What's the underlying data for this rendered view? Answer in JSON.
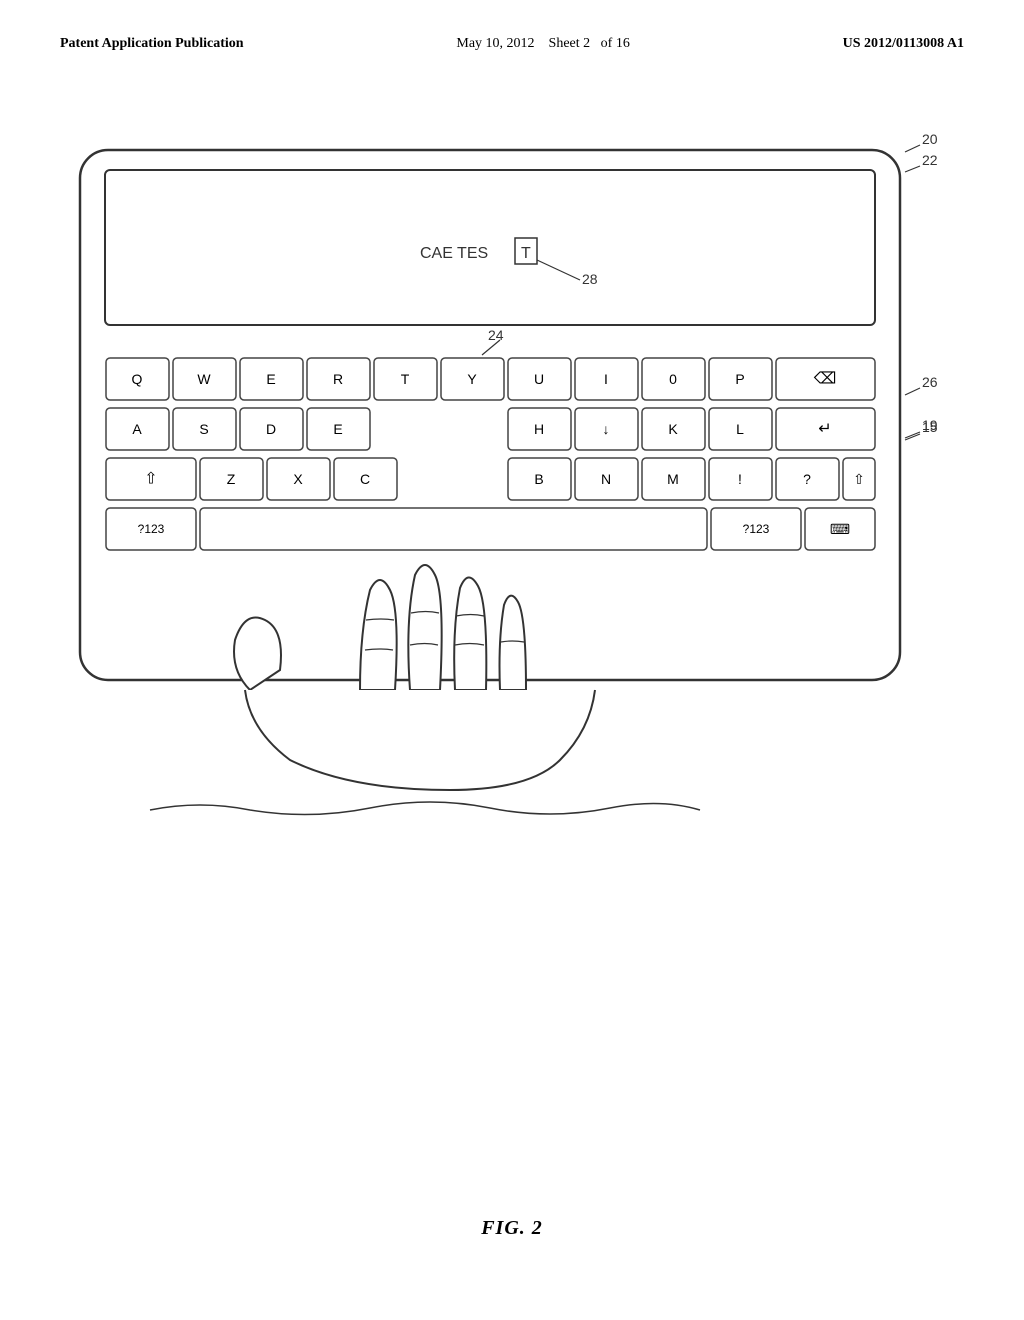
{
  "header": {
    "left": "Patent Application Publication",
    "center_date": "May 10, 2012",
    "center_sheet": "Sheet 2",
    "center_of": "of 16",
    "right": "US 2012/0113008 A1"
  },
  "figure": {
    "caption": "FIG. 2",
    "labels": {
      "device_outer": "20",
      "device_inner": "22",
      "keyboard_area": "24",
      "backspace_row": "26",
      "enter_row": "19",
      "cursor_label": "28",
      "side_label": "15"
    }
  },
  "screen": {
    "text": "CAE TES",
    "cursor_char": "T"
  },
  "keyboard": {
    "row1": [
      "Q",
      "W",
      "E",
      "R",
      "T",
      "Y",
      "U",
      "I",
      "0",
      "P",
      "⌫"
    ],
    "row2": [
      "A",
      "S",
      "D",
      "E",
      "",
      "H",
      "↓",
      "K",
      "L",
      "↵"
    ],
    "row3": [
      "⇧",
      "Z",
      "X",
      "C",
      "",
      "B",
      "N",
      "M",
      "!",
      "?",
      "⇧"
    ],
    "row4_left": "?123",
    "row4_right": "?123",
    "row4_keyboard_icon": "⌨"
  }
}
